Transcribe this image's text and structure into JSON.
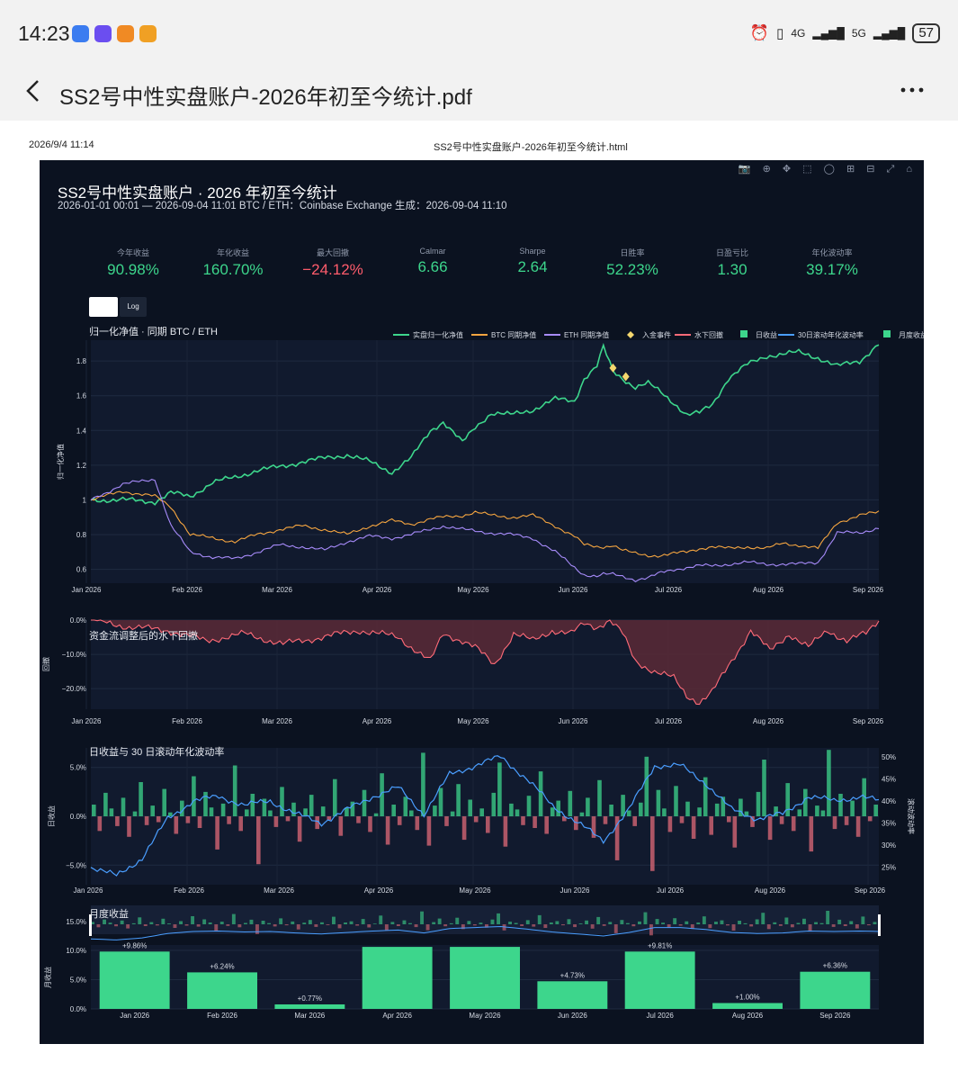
{
  "status": {
    "time": "14:23",
    "network": "4G",
    "network2": "5G",
    "battery": "57",
    "app_icon_colors": [
      "#3b7cf0",
      "#6b4ef0",
      "#f08a24",
      "#f0a024"
    ]
  },
  "header": {
    "title": "SS2号中性实盘账户-2026年初至今统计.pdf",
    "back_icon": "chevron-left-icon",
    "more_icon": "more-dots-icon"
  },
  "print_header": {
    "datetime": "2026/9/4 11:14",
    "filename": "SS2号中性实盘账户-2026年初至今统计.html"
  },
  "dashboard": {
    "title": "SS2号中性实盘账户 · 2026 年初至今统计",
    "subtitle": "2026-01-01 00:01 — 2026-09-04 11:01    BTC / ETH：Coinbase Exchange    生成：2026-09-04 11:10",
    "kpis": [
      {
        "label": "今年收益",
        "value": "90.98%",
        "color": "#3dd68c"
      },
      {
        "label": "年化收益",
        "value": "160.70%",
        "color": "#3dd68c"
      },
      {
        "label": "最大回撤",
        "value": "−24.12%",
        "color": "#ff5c6c"
      },
      {
        "label": "Calmar",
        "value": "6.66",
        "color": "#3dd68c"
      },
      {
        "label": "Sharpe",
        "value": "2.64",
        "color": "#3dd68c"
      },
      {
        "label": "日胜率",
        "value": "52.23%",
        "color": "#3dd68c"
      },
      {
        "label": "日盈亏比",
        "value": "1.30",
        "color": "#3dd68c"
      },
      {
        "label": "年化波动率",
        "value": "39.17%",
        "color": "#3dd68c"
      }
    ],
    "scale_buttons": {
      "linear": "",
      "log": "Log"
    },
    "colors": {
      "strategy": "#3dd68c",
      "btc": "#f5a540",
      "eth": "#a78bfa",
      "drawdown": "#ff6b78",
      "vol": "#4a9eff",
      "event": "#f5d76e",
      "neg": "#e06a78"
    }
  },
  "chart_data": [
    {
      "type": "line",
      "title": "归一化净值 · 同期 BTC / ETH",
      "ylabel": "归一化净值",
      "xlabels": [
        "Jan 2026",
        "Feb 2026",
        "Mar 2026",
        "Apr 2026",
        "May 2026",
        "Jun 2026",
        "Jul 2026",
        "Aug 2026",
        "Sep 2026"
      ],
      "yticks": [
        "0.6",
        "0.8",
        "1",
        "1.2",
        "1.4",
        "1.6",
        "1.8"
      ],
      "ylim": [
        0.52,
        1.92
      ],
      "x": [
        0,
        10,
        20,
        25,
        31,
        38,
        45,
        52,
        59,
        66,
        73,
        80,
        87,
        94,
        100,
        106,
        110,
        116,
        120,
        125,
        131,
        138,
        145,
        151,
        154,
        158,
        160,
        163,
        166,
        170,
        174,
        178,
        182,
        186,
        190,
        194,
        199,
        205,
        211,
        216,
        221,
        227,
        233,
        240,
        246
      ],
      "series": [
        {
          "name": "实盘归一化净值",
          "values": [
            1.0,
            1.0,
            0.99,
            1.04,
            1.02,
            1.1,
            1.13,
            1.17,
            1.19,
            1.22,
            1.24,
            1.26,
            1.22,
            1.16,
            1.24,
            1.4,
            1.45,
            1.33,
            1.42,
            1.5,
            1.49,
            1.52,
            1.58,
            1.57,
            1.7,
            1.77,
            1.88,
            1.74,
            1.7,
            1.65,
            1.67,
            1.62,
            1.56,
            1.49,
            1.5,
            1.55,
            1.7,
            1.78,
            1.83,
            1.84,
            1.85,
            1.82,
            1.77,
            1.8,
            1.9
          ]
        },
        {
          "name": "BTC 同期净值",
          "values": [
            1.0,
            1.05,
            1.02,
            0.96,
            0.8,
            0.78,
            0.76,
            0.8,
            0.83,
            0.85,
            0.83,
            0.8,
            0.85,
            0.88,
            0.86,
            0.89,
            0.9,
            0.91,
            0.93,
            0.91,
            0.9,
            0.91,
            0.85,
            0.79,
            0.74,
            0.73,
            0.73,
            0.74,
            0.71,
            0.69,
            0.68,
            0.68,
            0.69,
            0.7,
            0.72,
            0.73,
            0.72,
            0.73,
            0.72,
            0.75,
            0.74,
            0.72,
            0.87,
            0.91,
            0.93
          ]
        },
        {
          "name": "ETH 同期净值",
          "values": [
            1.0,
            1.09,
            1.12,
            0.85,
            0.7,
            0.67,
            0.66,
            0.7,
            0.74,
            0.73,
            0.71,
            0.76,
            0.79,
            0.78,
            0.8,
            0.83,
            0.85,
            0.83,
            0.82,
            0.81,
            0.8,
            0.78,
            0.7,
            0.61,
            0.57,
            0.56,
            0.57,
            0.57,
            0.56,
            0.54,
            0.55,
            0.58,
            0.6,
            0.61,
            0.62,
            0.62,
            0.63,
            0.64,
            0.63,
            0.63,
            0.63,
            0.64,
            0.81,
            0.81,
            0.84
          ]
        }
      ],
      "events": [
        {
          "x": 163,
          "y": 1.76
        },
        {
          "x": 167,
          "y": 1.71
        }
      ],
      "legend": [
        "实盘归一化净值",
        "BTC 同期净值",
        "ETH 同期净值",
        "入金事件",
        "水下回撤",
        "日收益",
        "30日滚动年化波动率",
        "月度收益"
      ]
    },
    {
      "type": "area",
      "title": "资金流调整后的水下回撤",
      "ylabel": "回撤",
      "yticks": [
        "0.0%",
        "−10.0%",
        "−20.0%"
      ],
      "ylim": [
        -26,
        0
      ],
      "x": [
        0,
        12,
        24,
        36,
        48,
        60,
        72,
        84,
        96,
        106,
        110,
        116,
        120,
        126,
        132,
        138,
        144,
        150,
        154,
        158,
        162,
        166,
        170,
        176,
        182,
        186,
        190,
        194,
        200,
        206,
        212,
        218,
        224,
        230,
        236,
        242,
        246
      ],
      "values": [
        0,
        -2,
        -3,
        -6,
        -4,
        -7,
        -5,
        -3,
        -5,
        -12,
        -4,
        -6,
        -8,
        -13,
        -4,
        -6,
        -3,
        -4,
        -1,
        -2,
        0,
        -4,
        -12,
        -15,
        -17,
        -22,
        -24,
        -21,
        -12,
        -3,
        -9,
        -4,
        -8,
        -3,
        -6,
        -4,
        0
      ]
    },
    {
      "type": "bar",
      "title": "日收益与 30 日滚动年化波动率",
      "ylabel": "日收益",
      "y2label": "滚动波动率",
      "yticks": [
        "5.0%",
        "0.0%",
        "−5.0%"
      ],
      "y2ticks": [
        "50%",
        "45%",
        "40%",
        "35%",
        "30%",
        "25%"
      ],
      "ylim": [
        -7,
        7
      ],
      "y2lim": [
        21,
        52
      ],
      "bars": [
        1.2,
        -1.5,
        2.4,
        0.8,
        -1.0,
        1.9,
        -2.1,
        0.5,
        3.5,
        -0.9,
        1.1,
        -0.6,
        2.8,
        0.4,
        -1.8,
        1.6,
        -0.7,
        4.1,
        -1.2,
        2.5,
        0.9,
        -3.4,
        1.3,
        -0.8,
        5.2,
        -1.5,
        0.7,
        2.3,
        -4.9,
        1.8,
        0.6,
        -1.1,
        3.0,
        -0.5,
        1.4,
        -2.6,
        0.8,
        2.2,
        -1.3,
        1.0,
        -0.4,
        3.8,
        -2.0,
        0.9,
        1.5,
        -0.7,
        2.7,
        -1.6,
        0.3,
        4.4,
        -2.9,
        1.2,
        -0.9,
        2.0,
        0.6,
        -1.4,
        6.5,
        -3.0,
        1.1,
        2.9,
        -1.0,
        0.5,
        3.3,
        -2.4,
        1.7,
        -0.6,
        0.8,
        -1.7,
        2.4,
        5.5,
        -3.1,
        1.3,
        0.7,
        -0.9,
        2.1,
        -1.2,
        4.6,
        -1.8,
        0.9,
        1.6,
        -0.5,
        2.6,
        -1.4,
        0.4,
        1.9,
        -2.2,
        3.7,
        -0.8,
        1.2,
        -4.5,
        2.2,
        0.6,
        -1.0,
        1.4,
        6.1,
        -5.6,
        2.7,
        0.8,
        -1.6,
        3.1,
        -0.7,
        1.5,
        -2.3,
        0.9,
        4.0,
        -1.9,
        1.3,
        2.0,
        -0.6,
        -3.2,
        1.8,
        0.5,
        -1.1,
        2.5,
        5.8,
        -2.4,
        1.0,
        -0.8,
        3.4,
        -1.5,
        0.7,
        2.8,
        -3.6,
        1.1,
        0.6,
        6.8,
        -1.3,
        2.3,
        -0.9,
        1.6,
        -2.1,
        3.9,
        -0.5,
        1.2
      ],
      "vol_x": [
        0,
        8,
        16,
        24,
        32,
        40,
        48,
        56,
        64,
        72,
        80,
        88,
        96,
        104,
        112,
        120,
        128,
        136,
        144,
        152,
        160,
        168,
        176,
        184,
        192,
        200,
        208,
        216,
        224,
        232,
        240,
        246
      ],
      "vol": [
        25,
        23,
        27,
        36,
        40,
        41,
        39,
        40,
        37,
        35,
        38,
        41,
        43,
        37,
        46,
        48,
        50,
        45,
        39,
        35,
        31,
        38,
        48,
        48,
        44,
        38,
        36,
        37,
        41,
        40,
        41,
        40
      ]
    },
    {
      "type": "bar",
      "title": "月度收益",
      "ylabel": "月收益",
      "yticks": [
        "15.0%",
        "10.0%",
        "5.0%",
        "0.0%"
      ],
      "ylim": [
        0,
        12
      ],
      "categories": [
        "Jan 2026",
        "Feb 2026",
        "Mar 2026",
        "Apr 2026",
        "May 2026",
        "Jun 2026",
        "Jul 2026",
        "Aug 2026",
        "Sep 2026"
      ],
      "values": [
        9.8,
        6.24,
        0.77,
        10.6,
        10.6,
        4.73,
        9.8,
        1.0,
        6.36
      ],
      "labels": [
        "+9.86%",
        "+6.24%",
        "+0.77%",
        "",
        "",
        "+4.73%",
        "+9.81%",
        "+1.00%",
        "+6.36%"
      ]
    }
  ]
}
